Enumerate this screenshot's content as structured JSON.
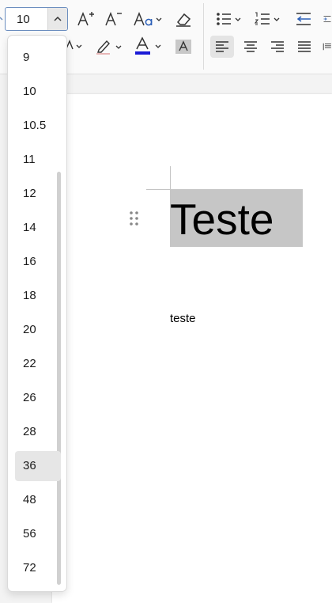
{
  "ribbon": {
    "font_size_value": "10"
  },
  "font_size_dropdown": {
    "options": [
      "9",
      "10",
      "10.5",
      "11",
      "12",
      "14",
      "16",
      "18",
      "20",
      "22",
      "26",
      "28",
      "36",
      "48",
      "56",
      "72"
    ],
    "selected": "36"
  },
  "document": {
    "title": "Teste",
    "body": "teste"
  },
  "colors": {
    "font_color_bar": "#1a1ad6",
    "accent_arrows": "#2b5fb8",
    "selection_highlight": "#c6c6c6"
  }
}
